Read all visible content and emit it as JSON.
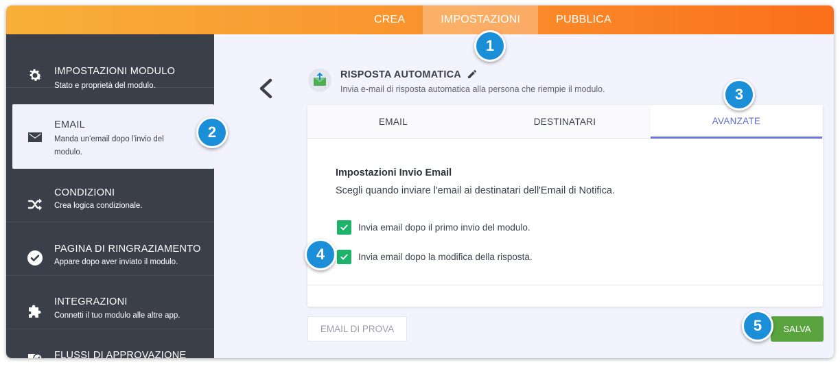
{
  "topnav": {
    "tabs": [
      {
        "label": "CREA"
      },
      {
        "label": "IMPOSTAZIONI"
      },
      {
        "label": "PUBBLICA"
      }
    ]
  },
  "sidebar": {
    "items": [
      {
        "title": "IMPOSTAZIONI MODULO",
        "desc": "Stato e proprietà del modulo.",
        "icon": "gear-icon"
      },
      {
        "title": "EMAIL",
        "desc": "Manda un'email dopo l'invio del modulo.",
        "icon": "envelope-icon"
      },
      {
        "title": "CONDIZIONI",
        "desc": "Crea logica condizionale.",
        "icon": "shuffle-icon"
      },
      {
        "title": "PAGINA DI RINGRAZIAMENTO",
        "desc": "Appare dopo aver inviato il modulo.",
        "icon": "check-circle-icon"
      },
      {
        "title": "INTEGRAZIONI",
        "desc": "Connetti il tuo modulo alle altre app.",
        "icon": "puzzle-icon"
      },
      {
        "title": "FLUSSI DI APPROVAZIONE",
        "desc": "",
        "icon": "approval-flow-icon"
      }
    ]
  },
  "header": {
    "title": "RISPOSTA AUTOMATICA",
    "description": "Invia e-mail di risposta automatica alla persona che riempie il modulo."
  },
  "panel": {
    "tabs": [
      {
        "label": "EMAIL"
      },
      {
        "label": "DESTINATARI"
      },
      {
        "label": "AVANZATE"
      }
    ],
    "section_title": "Impostazioni Invio Email",
    "section_desc": "Scegli quando inviare l'email ai destinatari dell'Email di Notifica.",
    "options": [
      {
        "label": "Invia email dopo il primo invio del modulo.",
        "checked": true
      },
      {
        "label": "Invia email dopo la modifica della risposta.",
        "checked": true
      }
    ]
  },
  "buttons": {
    "test_email": "EMAIL DI PROVA",
    "save": "SALVA"
  },
  "markers": [
    "1",
    "2",
    "3",
    "4",
    "5"
  ],
  "colors": {
    "accent_orange": "#f9902c",
    "sidebar_bg": "#3b3f4a",
    "active_tab": "#5b6bd0",
    "checkbox_green": "#1db36a",
    "save_green": "#5aa440",
    "marker_blue": "#1a8fd8"
  }
}
